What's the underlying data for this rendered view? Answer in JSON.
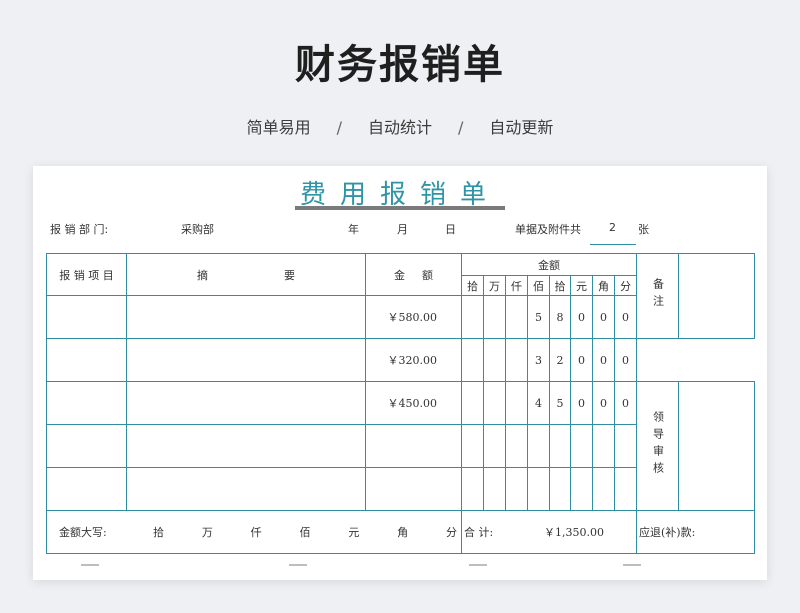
{
  "poster": {
    "title": "财务报销单",
    "features": [
      "简单易用",
      "自动统计",
      "自动更新"
    ],
    "separator": "/"
  },
  "form": {
    "title": "费用报销单",
    "dept_label": "报 销 部 门:",
    "dept_value": "采购部",
    "year_label": "年",
    "month_label": "月",
    "day_label": "日",
    "attach_label": "单据及附件共",
    "attach_count": "2",
    "attach_unit": "张"
  },
  "table": {
    "header_item": "报 销 项 目",
    "header_summary_1": "摘",
    "header_summary_2": "要",
    "header_amount_1": "金",
    "header_amount_2": "额",
    "header_amount_group": "金额",
    "digit_headers": [
      "拾",
      "万",
      "仟",
      "佰",
      "拾",
      "元",
      "角",
      "分"
    ],
    "remark_label": "备注",
    "review_label": "领导审核",
    "rows": [
      {
        "amount": "￥580.00",
        "digits": [
          "",
          "",
          "",
          "5",
          "8",
          "0",
          "0",
          "0"
        ]
      },
      {
        "amount": "￥320.00",
        "digits": [
          "",
          "",
          "",
          "3",
          "2",
          "0",
          "0",
          "0"
        ]
      },
      {
        "amount": "￥450.00",
        "digits": [
          "",
          "",
          "",
          "4",
          "5",
          "0",
          "0",
          "0"
        ]
      },
      {
        "amount": "",
        "digits": [
          "",
          "",
          "",
          "",
          "",
          "",
          "",
          ""
        ]
      },
      {
        "amount": "",
        "digits": [
          "",
          "",
          "",
          "",
          "",
          "",
          "",
          ""
        ]
      }
    ],
    "footer": {
      "capital_label": "金额大写:",
      "capital_units": [
        "拾",
        "万",
        "仟",
        "佰",
        "元",
        "角",
        "分"
      ],
      "total_label": "合  计:",
      "total_value": "￥1,350.00",
      "refund_label": "应退(补)款:"
    }
  }
}
